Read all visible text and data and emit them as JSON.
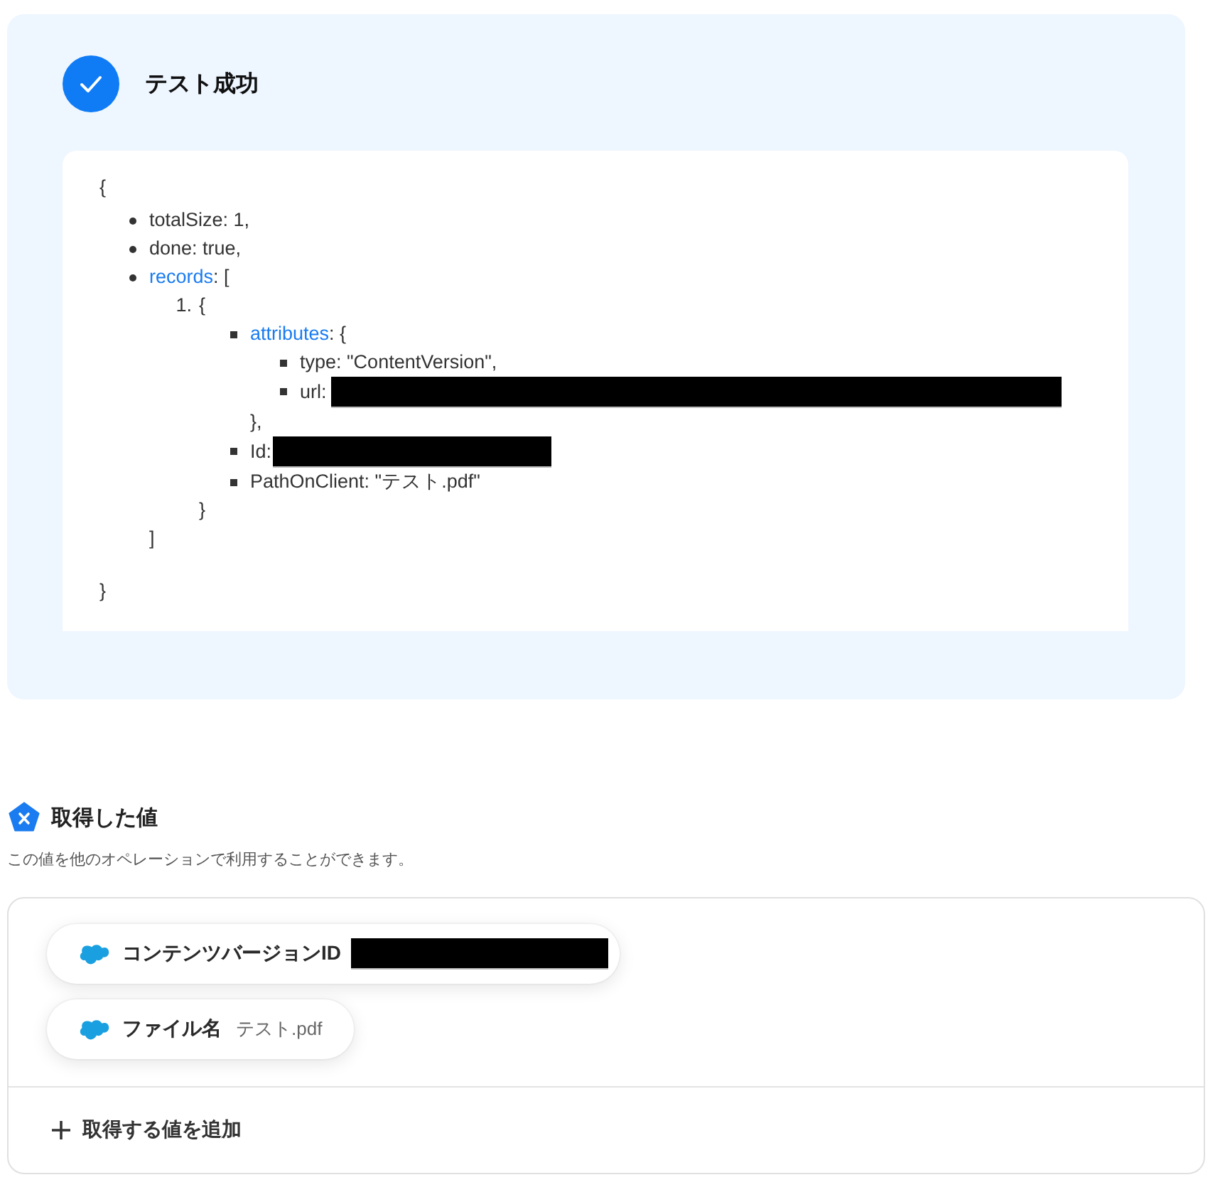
{
  "test_result": {
    "passed": true,
    "title": "テスト成功",
    "output": {
      "open": "{",
      "close": "}",
      "entries": [
        {
          "text": "totalSize: 1,"
        },
        {
          "text": "done: true,"
        },
        {
          "key": "records",
          "text": ": [",
          "close": "]",
          "records": [
            {
              "number": "1.",
              "text": "{",
              "close": "}",
              "entries": [
                {
                  "key": "attributes",
                  "text": ": {",
                  "close": "},",
                  "entries": [
                    {
                      "text": "type: \"ContentVersion\","
                    },
                    {
                      "text": "url:",
                      "redacted": true
                    }
                  ]
                },
                {
                  "text": "Id:",
                  "redacted": true
                },
                {
                  "text": "PathOnClient: \"テスト.pdf\""
                }
              ]
            }
          ]
        }
      ]
    }
  },
  "obtained_values": {
    "title": "取得した値",
    "description": "この値を他のオペレーションで利用することができます。",
    "values": [
      {
        "label": "コンテンツバージョンID",
        "redacted": true
      },
      {
        "label": "ファイル名",
        "value": "テスト.pdf",
        "redacted": false
      }
    ],
    "add_button": "取得する値を追加"
  }
}
